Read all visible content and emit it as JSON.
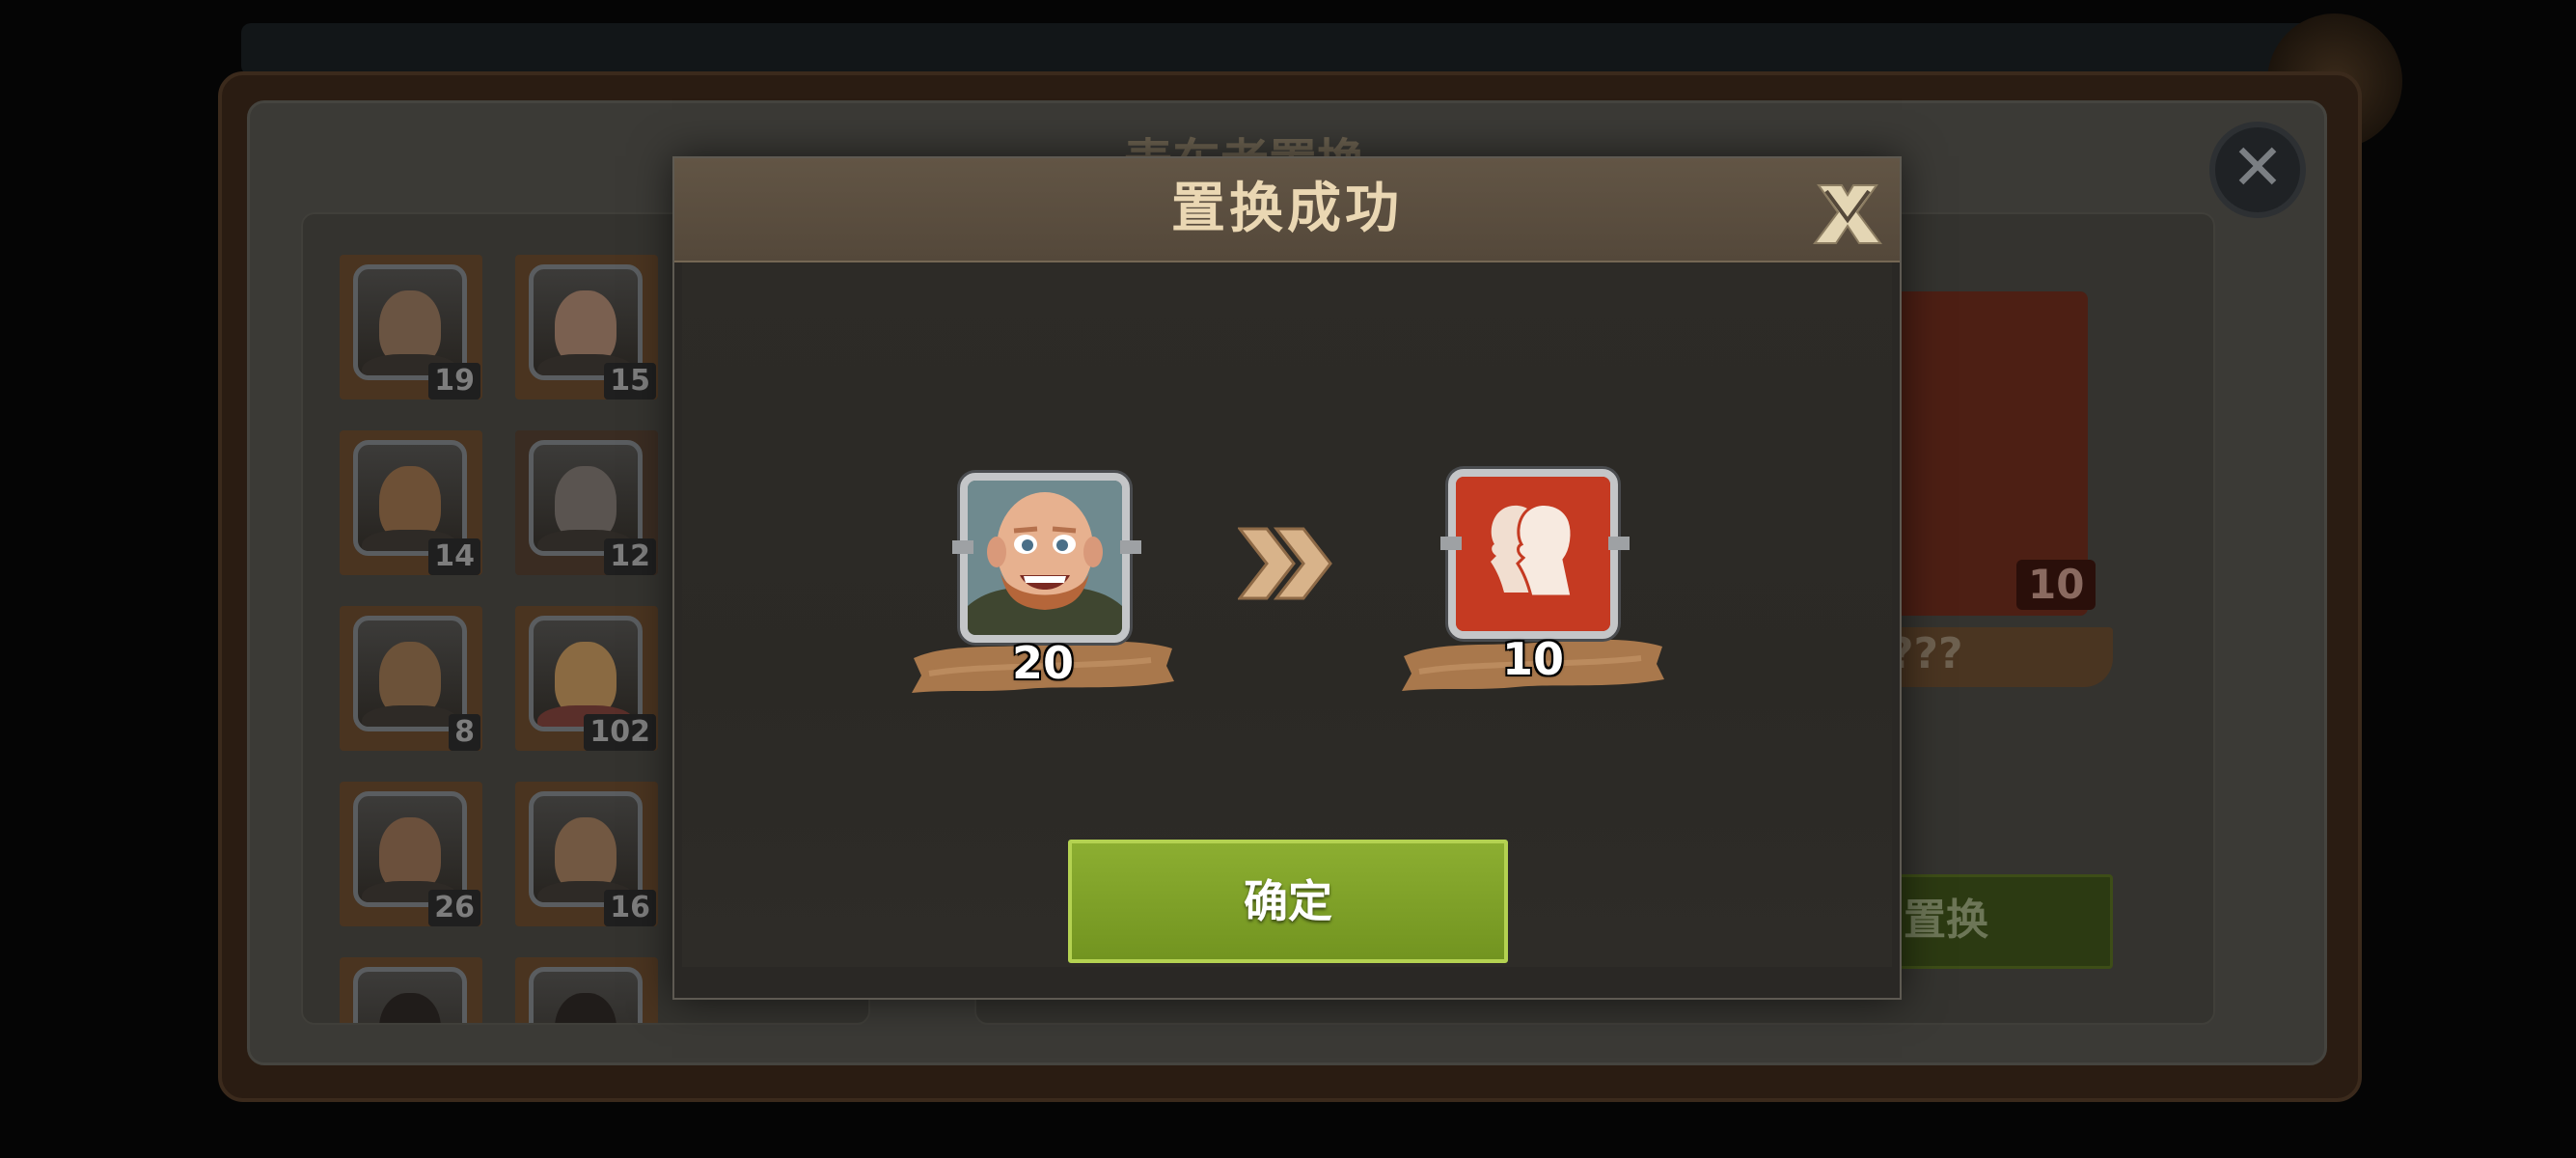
{
  "background": {
    "title": "麦车者置换",
    "hero_counts": [
      "19",
      "15",
      "14",
      "12",
      "8",
      "102",
      "26",
      "16"
    ],
    "right_card_count": "10",
    "right_card_name": "???",
    "swap_button": "置换"
  },
  "modal": {
    "title": "置换成功",
    "from_count": "20",
    "to_count": "10",
    "confirm_label": "确定"
  },
  "colors": {
    "confirm_green": "#7fa12a",
    "title_text": "#ead7b3",
    "fragment_red": "#c53a22",
    "banner_tan": "#a9784c"
  },
  "icons": {
    "close": "close-x-icon",
    "arrow": "double-chevron-right-icon",
    "fragment": "hero-fragment-silhouette-icon"
  }
}
